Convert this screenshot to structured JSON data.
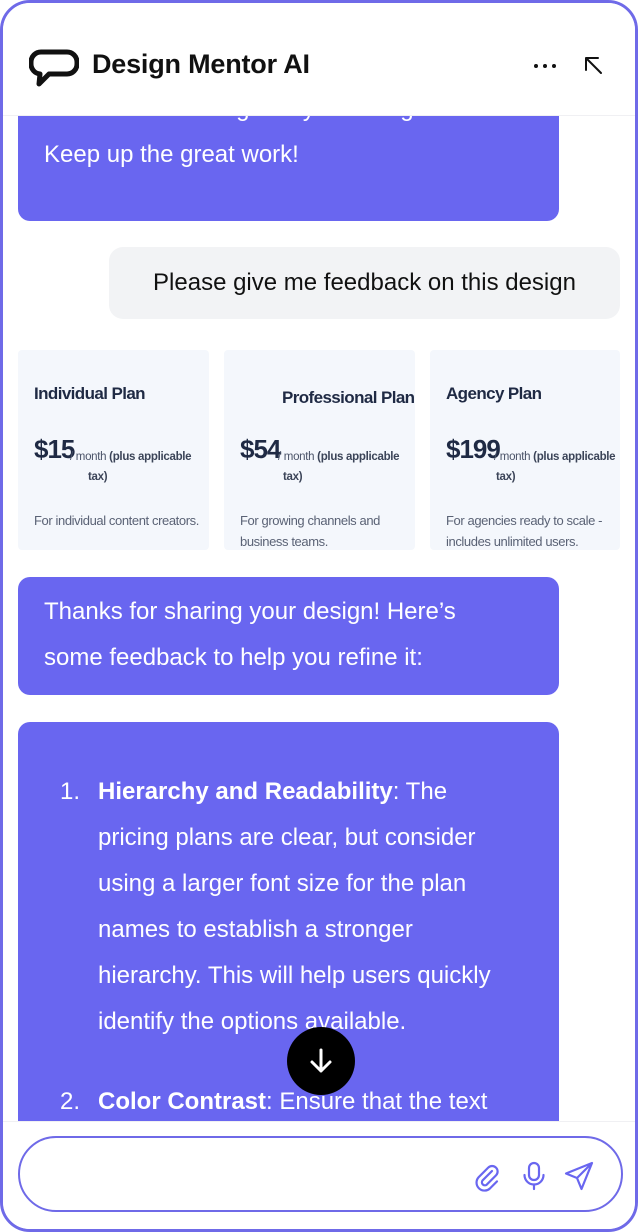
{
  "header": {
    "title": "Design Mentor AI",
    "logo_icon": "chat-bubble-icon",
    "menu_icon": "more-horizontal-icon",
    "collapse_icon": "arrow-up-left-icon"
  },
  "messages": {
    "ai_prev": {
      "line1": "uniform look throughout your design.",
      "line2": "Keep up the great work!"
    },
    "user": {
      "text": "Please give me feedback on this design"
    },
    "pricing_image": {
      "plans": [
        {
          "name": "Individual Plan",
          "price": "$15",
          "unit": "/ month",
          "tax_a": "(plus applicable",
          "tax_b": "tax)",
          "desc_a": "For individual content creators.",
          "desc_b": ""
        },
        {
          "name": "Professional Plan",
          "price": "$54",
          "unit": "/ month",
          "tax_a": "(plus applicable",
          "tax_b": "tax)",
          "desc_a": "For growing channels and",
          "desc_b": "business teams."
        },
        {
          "name": "Agency Plan",
          "price": "$199",
          "unit": "/ month",
          "tax_a": "(plus applicable",
          "tax_b": "tax)",
          "desc_a": "For agencies ready to scale -",
          "desc_b": "includes unlimited users."
        }
      ]
    },
    "ai_intro": {
      "line1": "Thanks for sharing your design! Here’s",
      "line2": "some feedback to help you refine it:"
    },
    "ai_list": {
      "items": [
        {
          "num": "1.",
          "title": "Hierarchy and Readability",
          "lines": [
            ": The",
            "pricing plans are clear, but consider",
            "using a larger font size for the plan",
            "names to establish a stronger",
            "hierarchy. This will help users quickly",
            "identify the options available."
          ]
        },
        {
          "num": "2.",
          "title": "Color Contrast",
          "lines": [
            ": Ensure that the text"
          ]
        }
      ]
    }
  },
  "composer": {
    "placeholder": "",
    "value": "",
    "attach_icon": "paperclip-icon",
    "mic_icon": "microphone-icon",
    "send_icon": "send-icon"
  },
  "scroll_icon": "arrow-down-icon",
  "colors": {
    "accent": "#6966f0",
    "border": "#6f6ae8",
    "user_bubble": "#f2f3f5",
    "pricing_card": "#f4f7fc"
  }
}
